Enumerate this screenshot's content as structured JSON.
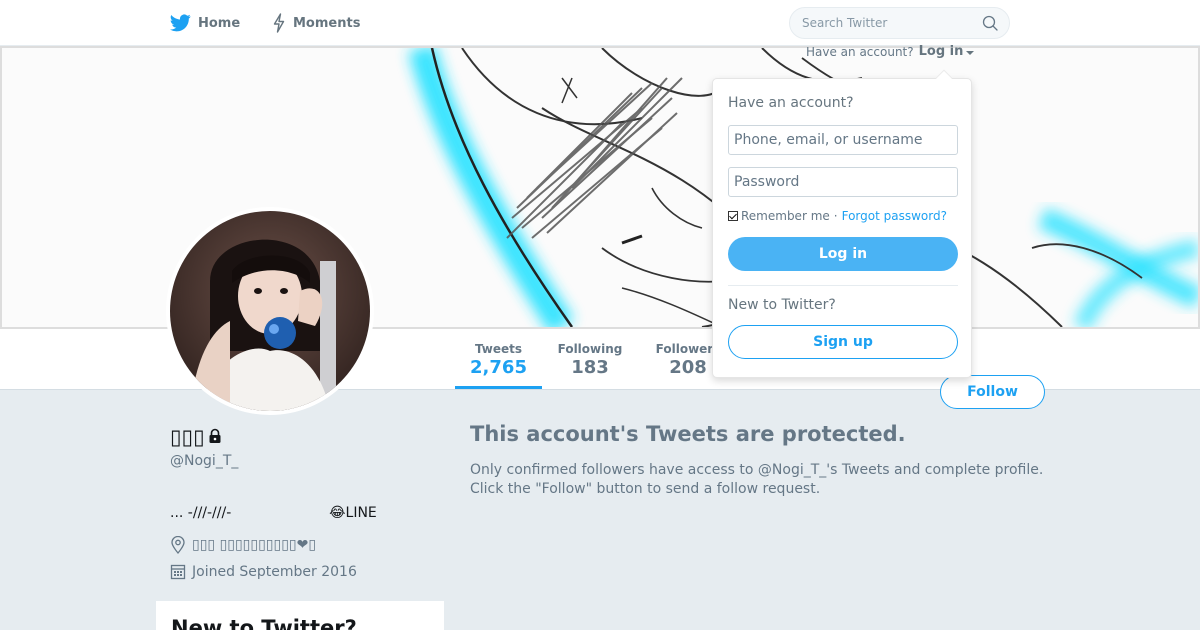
{
  "topnav": {
    "home_label": "Home",
    "moments_label": "Moments",
    "search_placeholder": "Search Twitter"
  },
  "login": {
    "hint": "Have an account?",
    "trigger_label": "Log in",
    "dropdown": {
      "heading": "Have an account?",
      "username_placeholder": "Phone, email, or username",
      "password_placeholder": "Password",
      "remember_label": "Remember me",
      "separator": "·",
      "forgot_label": "Forgot password?",
      "login_button": "Log in",
      "new_heading": "New to Twitter?",
      "signup_button": "Sign up"
    }
  },
  "stats": {
    "tweets": {
      "label": "Tweets",
      "value": "2,765"
    },
    "following": {
      "label": "Following",
      "value": "183"
    },
    "followers": {
      "label": "Followers",
      "value": "208"
    }
  },
  "follow_button": "Follow",
  "profile": {
    "fullname": "▯▯▯",
    "screenname": "@Nogi_T_",
    "bio": "... -///-///-                      😂LINE",
    "location": "▯▯▯ ▯▯▯▯▯▯▯▯▯▯❤▯",
    "joined": "Joined September 2016"
  },
  "signup_card": {
    "heading": "New to Twitter?"
  },
  "protected": {
    "title": "This account's Tweets are protected.",
    "body": "Only confirmed followers have access to @Nogi_T_'s Tweets and complete profile. Click the \"Follow\" button to send a follow request."
  },
  "colors": {
    "accent": "#1da1f2",
    "login_button": "#4ab3f4",
    "page_background": "#e6ecf0",
    "muted_text": "#657786"
  }
}
